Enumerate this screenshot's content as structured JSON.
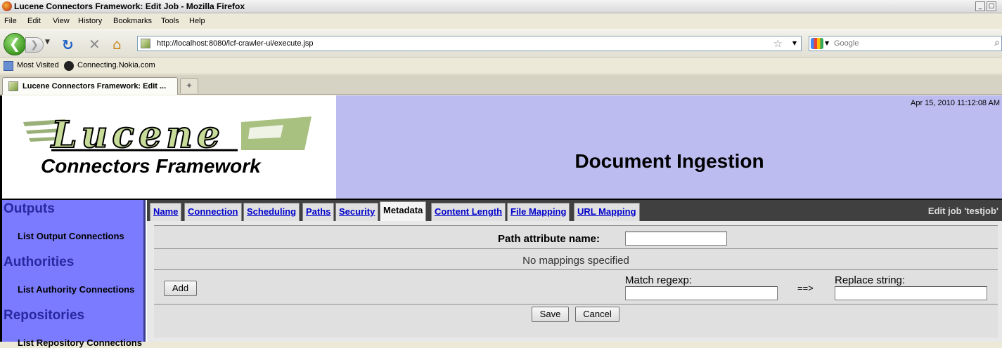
{
  "window": {
    "title": "Lucene Connectors Framework: Edit Job - Mozilla Firefox",
    "controls": [
      "_",
      "□",
      "✕"
    ]
  },
  "menu": [
    "File",
    "Edit",
    "View",
    "History",
    "Bookmarks",
    "Tools",
    "Help"
  ],
  "nav": {
    "url": "http://localhost:8080/lcf-crawler-ui/execute.jsp",
    "search_placeholder": "Google"
  },
  "bookmarks": [
    "Most Visited",
    "Connecting.Nokia.com"
  ],
  "tabs": {
    "active_label": "Lucene Connectors Framework: Edit ...",
    "new_tab_icon": "new-tab-icon"
  },
  "header": {
    "logo_word": "Lucene",
    "logo_sub": "Connectors Framework",
    "date": "Apr 15, 2010 11:12:08 AM",
    "title": "Document Ingestion"
  },
  "sidebar": {
    "sections": [
      {
        "title": "Outputs",
        "link": "List Output Connections"
      },
      {
        "title": "Authorities",
        "link": "List Authority Connections"
      },
      {
        "title": "Repositories",
        "link": "List Repository Connections"
      }
    ]
  },
  "job_tabs": [
    "Name",
    "Connection",
    "Scheduling",
    "Paths",
    "Security",
    "Metadata",
    "Content Length",
    "File Mapping",
    "URL Mapping"
  ],
  "active_job_tab": "Metadata",
  "edit_label": "Edit job 'testjob'",
  "form": {
    "path_attribute_label": "Path attribute name:",
    "path_attribute_value": "",
    "no_mappings": "No mappings specified",
    "add_button": "Add",
    "match_label": "Match regexp:",
    "arrow": "==>",
    "replace_label": "Replace string:",
    "match_value": "",
    "replace_value": "",
    "save_button": "Save",
    "cancel_button": "Cancel"
  }
}
